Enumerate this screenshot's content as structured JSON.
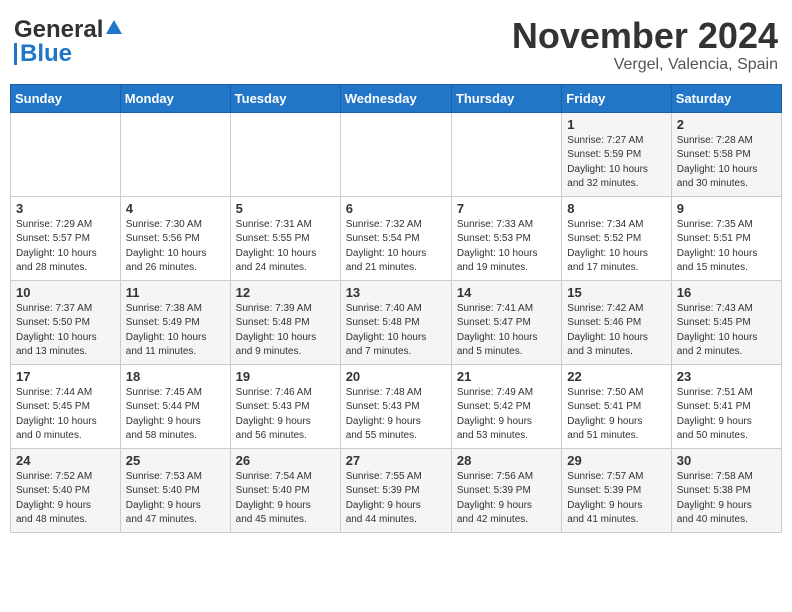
{
  "header": {
    "logo_general": "General",
    "logo_blue": "Blue",
    "month": "November 2024",
    "location": "Vergel, Valencia, Spain"
  },
  "weekdays": [
    "Sunday",
    "Monday",
    "Tuesday",
    "Wednesday",
    "Thursday",
    "Friday",
    "Saturday"
  ],
  "weeks": [
    [
      {
        "day": "",
        "info": ""
      },
      {
        "day": "",
        "info": ""
      },
      {
        "day": "",
        "info": ""
      },
      {
        "day": "",
        "info": ""
      },
      {
        "day": "",
        "info": ""
      },
      {
        "day": "1",
        "info": "Sunrise: 7:27 AM\nSunset: 5:59 PM\nDaylight: 10 hours\nand 32 minutes."
      },
      {
        "day": "2",
        "info": "Sunrise: 7:28 AM\nSunset: 5:58 PM\nDaylight: 10 hours\nand 30 minutes."
      }
    ],
    [
      {
        "day": "3",
        "info": "Sunrise: 7:29 AM\nSunset: 5:57 PM\nDaylight: 10 hours\nand 28 minutes."
      },
      {
        "day": "4",
        "info": "Sunrise: 7:30 AM\nSunset: 5:56 PM\nDaylight: 10 hours\nand 26 minutes."
      },
      {
        "day": "5",
        "info": "Sunrise: 7:31 AM\nSunset: 5:55 PM\nDaylight: 10 hours\nand 24 minutes."
      },
      {
        "day": "6",
        "info": "Sunrise: 7:32 AM\nSunset: 5:54 PM\nDaylight: 10 hours\nand 21 minutes."
      },
      {
        "day": "7",
        "info": "Sunrise: 7:33 AM\nSunset: 5:53 PM\nDaylight: 10 hours\nand 19 minutes."
      },
      {
        "day": "8",
        "info": "Sunrise: 7:34 AM\nSunset: 5:52 PM\nDaylight: 10 hours\nand 17 minutes."
      },
      {
        "day": "9",
        "info": "Sunrise: 7:35 AM\nSunset: 5:51 PM\nDaylight: 10 hours\nand 15 minutes."
      }
    ],
    [
      {
        "day": "10",
        "info": "Sunrise: 7:37 AM\nSunset: 5:50 PM\nDaylight: 10 hours\nand 13 minutes."
      },
      {
        "day": "11",
        "info": "Sunrise: 7:38 AM\nSunset: 5:49 PM\nDaylight: 10 hours\nand 11 minutes."
      },
      {
        "day": "12",
        "info": "Sunrise: 7:39 AM\nSunset: 5:48 PM\nDaylight: 10 hours\nand 9 minutes."
      },
      {
        "day": "13",
        "info": "Sunrise: 7:40 AM\nSunset: 5:48 PM\nDaylight: 10 hours\nand 7 minutes."
      },
      {
        "day": "14",
        "info": "Sunrise: 7:41 AM\nSunset: 5:47 PM\nDaylight: 10 hours\nand 5 minutes."
      },
      {
        "day": "15",
        "info": "Sunrise: 7:42 AM\nSunset: 5:46 PM\nDaylight: 10 hours\nand 3 minutes."
      },
      {
        "day": "16",
        "info": "Sunrise: 7:43 AM\nSunset: 5:45 PM\nDaylight: 10 hours\nand 2 minutes."
      }
    ],
    [
      {
        "day": "17",
        "info": "Sunrise: 7:44 AM\nSunset: 5:45 PM\nDaylight: 10 hours\nand 0 minutes."
      },
      {
        "day": "18",
        "info": "Sunrise: 7:45 AM\nSunset: 5:44 PM\nDaylight: 9 hours\nand 58 minutes."
      },
      {
        "day": "19",
        "info": "Sunrise: 7:46 AM\nSunset: 5:43 PM\nDaylight: 9 hours\nand 56 minutes."
      },
      {
        "day": "20",
        "info": "Sunrise: 7:48 AM\nSunset: 5:43 PM\nDaylight: 9 hours\nand 55 minutes."
      },
      {
        "day": "21",
        "info": "Sunrise: 7:49 AM\nSunset: 5:42 PM\nDaylight: 9 hours\nand 53 minutes."
      },
      {
        "day": "22",
        "info": "Sunrise: 7:50 AM\nSunset: 5:41 PM\nDaylight: 9 hours\nand 51 minutes."
      },
      {
        "day": "23",
        "info": "Sunrise: 7:51 AM\nSunset: 5:41 PM\nDaylight: 9 hours\nand 50 minutes."
      }
    ],
    [
      {
        "day": "24",
        "info": "Sunrise: 7:52 AM\nSunset: 5:40 PM\nDaylight: 9 hours\nand 48 minutes."
      },
      {
        "day": "25",
        "info": "Sunrise: 7:53 AM\nSunset: 5:40 PM\nDaylight: 9 hours\nand 47 minutes."
      },
      {
        "day": "26",
        "info": "Sunrise: 7:54 AM\nSunset: 5:40 PM\nDaylight: 9 hours\nand 45 minutes."
      },
      {
        "day": "27",
        "info": "Sunrise: 7:55 AM\nSunset: 5:39 PM\nDaylight: 9 hours\nand 44 minutes."
      },
      {
        "day": "28",
        "info": "Sunrise: 7:56 AM\nSunset: 5:39 PM\nDaylight: 9 hours\nand 42 minutes."
      },
      {
        "day": "29",
        "info": "Sunrise: 7:57 AM\nSunset: 5:39 PM\nDaylight: 9 hours\nand 41 minutes."
      },
      {
        "day": "30",
        "info": "Sunrise: 7:58 AM\nSunset: 5:38 PM\nDaylight: 9 hours\nand 40 minutes."
      }
    ]
  ]
}
